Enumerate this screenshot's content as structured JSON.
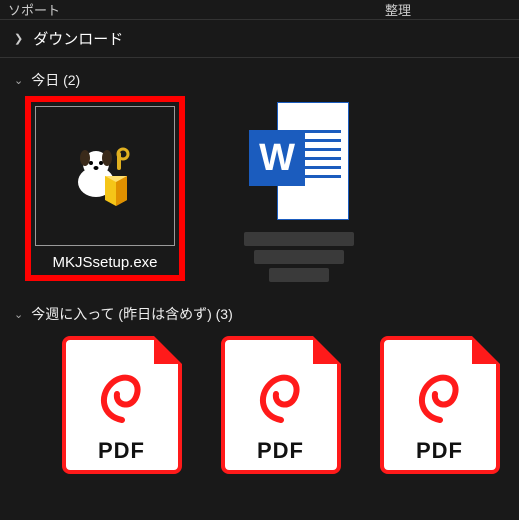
{
  "toolbar": {
    "left_label": "ソポート",
    "right_label": "整理"
  },
  "breadcrumb": {
    "location": "ダウンロード"
  },
  "groups": {
    "today": {
      "label": "今日 (2)"
    },
    "this_week": {
      "label": "今週に入って (昨日は含めず) (3)"
    }
  },
  "files": {
    "exe": {
      "name": "MKJSsetup.exe"
    }
  },
  "pdf": {
    "label": "PDF"
  }
}
